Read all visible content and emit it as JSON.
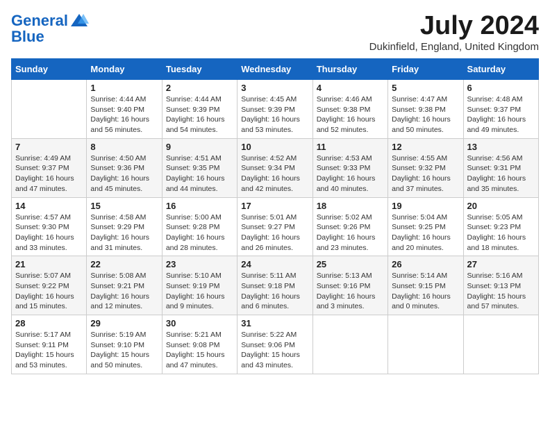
{
  "logo": {
    "line1": "General",
    "line2": "Blue"
  },
  "title": "July 2024",
  "subtitle": "Dukinfield, England, United Kingdom",
  "days_of_week": [
    "Sunday",
    "Monday",
    "Tuesday",
    "Wednesday",
    "Thursday",
    "Friday",
    "Saturday"
  ],
  "weeks": [
    [
      {
        "day": "",
        "info": ""
      },
      {
        "day": "1",
        "info": "Sunrise: 4:44 AM\nSunset: 9:40 PM\nDaylight: 16 hours\nand 56 minutes."
      },
      {
        "day": "2",
        "info": "Sunrise: 4:44 AM\nSunset: 9:39 PM\nDaylight: 16 hours\nand 54 minutes."
      },
      {
        "day": "3",
        "info": "Sunrise: 4:45 AM\nSunset: 9:39 PM\nDaylight: 16 hours\nand 53 minutes."
      },
      {
        "day": "4",
        "info": "Sunrise: 4:46 AM\nSunset: 9:38 PM\nDaylight: 16 hours\nand 52 minutes."
      },
      {
        "day": "5",
        "info": "Sunrise: 4:47 AM\nSunset: 9:38 PM\nDaylight: 16 hours\nand 50 minutes."
      },
      {
        "day": "6",
        "info": "Sunrise: 4:48 AM\nSunset: 9:37 PM\nDaylight: 16 hours\nand 49 minutes."
      }
    ],
    [
      {
        "day": "7",
        "info": "Sunrise: 4:49 AM\nSunset: 9:37 PM\nDaylight: 16 hours\nand 47 minutes."
      },
      {
        "day": "8",
        "info": "Sunrise: 4:50 AM\nSunset: 9:36 PM\nDaylight: 16 hours\nand 45 minutes."
      },
      {
        "day": "9",
        "info": "Sunrise: 4:51 AM\nSunset: 9:35 PM\nDaylight: 16 hours\nand 44 minutes."
      },
      {
        "day": "10",
        "info": "Sunrise: 4:52 AM\nSunset: 9:34 PM\nDaylight: 16 hours\nand 42 minutes."
      },
      {
        "day": "11",
        "info": "Sunrise: 4:53 AM\nSunset: 9:33 PM\nDaylight: 16 hours\nand 40 minutes."
      },
      {
        "day": "12",
        "info": "Sunrise: 4:55 AM\nSunset: 9:32 PM\nDaylight: 16 hours\nand 37 minutes."
      },
      {
        "day": "13",
        "info": "Sunrise: 4:56 AM\nSunset: 9:31 PM\nDaylight: 16 hours\nand 35 minutes."
      }
    ],
    [
      {
        "day": "14",
        "info": "Sunrise: 4:57 AM\nSunset: 9:30 PM\nDaylight: 16 hours\nand 33 minutes."
      },
      {
        "day": "15",
        "info": "Sunrise: 4:58 AM\nSunset: 9:29 PM\nDaylight: 16 hours\nand 31 minutes."
      },
      {
        "day": "16",
        "info": "Sunrise: 5:00 AM\nSunset: 9:28 PM\nDaylight: 16 hours\nand 28 minutes."
      },
      {
        "day": "17",
        "info": "Sunrise: 5:01 AM\nSunset: 9:27 PM\nDaylight: 16 hours\nand 26 minutes."
      },
      {
        "day": "18",
        "info": "Sunrise: 5:02 AM\nSunset: 9:26 PM\nDaylight: 16 hours\nand 23 minutes."
      },
      {
        "day": "19",
        "info": "Sunrise: 5:04 AM\nSunset: 9:25 PM\nDaylight: 16 hours\nand 20 minutes."
      },
      {
        "day": "20",
        "info": "Sunrise: 5:05 AM\nSunset: 9:23 PM\nDaylight: 16 hours\nand 18 minutes."
      }
    ],
    [
      {
        "day": "21",
        "info": "Sunrise: 5:07 AM\nSunset: 9:22 PM\nDaylight: 16 hours\nand 15 minutes."
      },
      {
        "day": "22",
        "info": "Sunrise: 5:08 AM\nSunset: 9:21 PM\nDaylight: 16 hours\nand 12 minutes."
      },
      {
        "day": "23",
        "info": "Sunrise: 5:10 AM\nSunset: 9:19 PM\nDaylight: 16 hours\nand 9 minutes."
      },
      {
        "day": "24",
        "info": "Sunrise: 5:11 AM\nSunset: 9:18 PM\nDaylight: 16 hours\nand 6 minutes."
      },
      {
        "day": "25",
        "info": "Sunrise: 5:13 AM\nSunset: 9:16 PM\nDaylight: 16 hours\nand 3 minutes."
      },
      {
        "day": "26",
        "info": "Sunrise: 5:14 AM\nSunset: 9:15 PM\nDaylight: 16 hours\nand 0 minutes."
      },
      {
        "day": "27",
        "info": "Sunrise: 5:16 AM\nSunset: 9:13 PM\nDaylight: 15 hours\nand 57 minutes."
      }
    ],
    [
      {
        "day": "28",
        "info": "Sunrise: 5:17 AM\nSunset: 9:11 PM\nDaylight: 15 hours\nand 53 minutes."
      },
      {
        "day": "29",
        "info": "Sunrise: 5:19 AM\nSunset: 9:10 PM\nDaylight: 15 hours\nand 50 minutes."
      },
      {
        "day": "30",
        "info": "Sunrise: 5:21 AM\nSunset: 9:08 PM\nDaylight: 15 hours\nand 47 minutes."
      },
      {
        "day": "31",
        "info": "Sunrise: 5:22 AM\nSunset: 9:06 PM\nDaylight: 15 hours\nand 43 minutes."
      },
      {
        "day": "",
        "info": ""
      },
      {
        "day": "",
        "info": ""
      },
      {
        "day": "",
        "info": ""
      }
    ]
  ]
}
